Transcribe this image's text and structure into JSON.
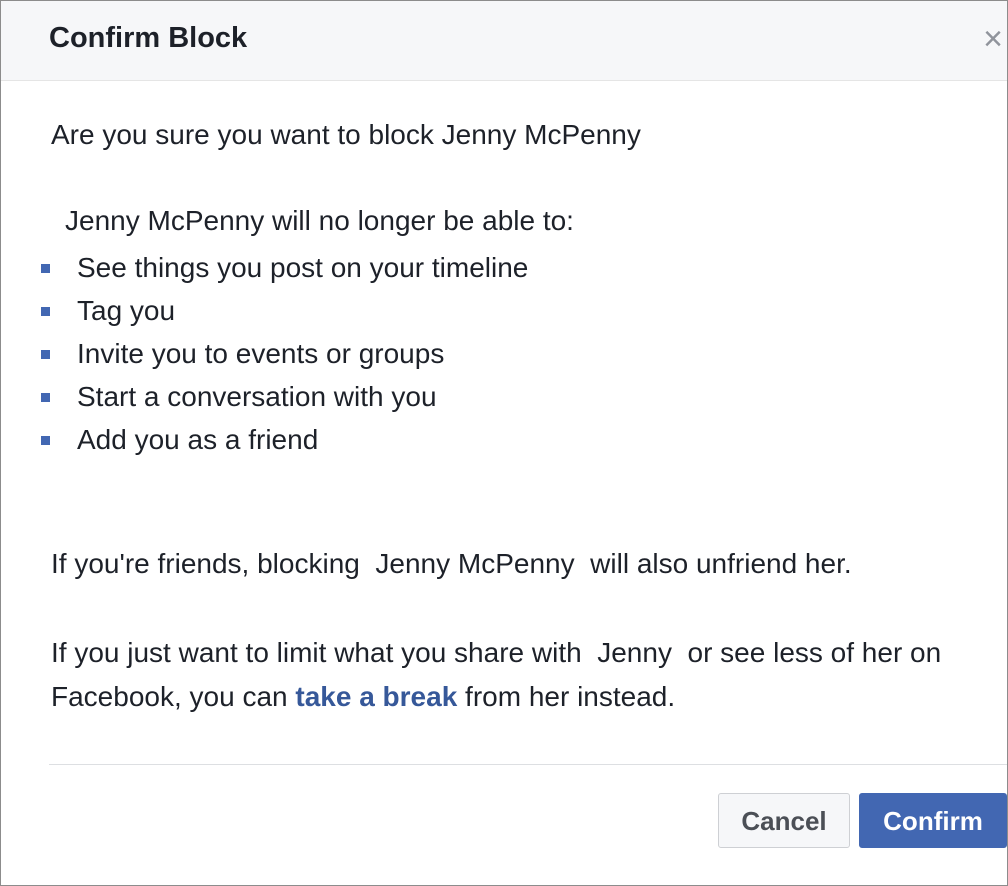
{
  "dialog": {
    "title": "Confirm Block",
    "close_glyph": "×"
  },
  "body": {
    "question": "Are you sure you want to block Jenny McPenny",
    "intro": "Jenny McPenny will no longer be able to:",
    "restrictions": [
      "See things you post on your timeline",
      "Tag you",
      "Invite you to events or groups",
      "Start a conversation with you",
      "Add you as a friend"
    ],
    "unfriend_note": "If you're friends, blocking  Jenny McPenny  will also unfriend her.",
    "limit_prefix": "If you just want to limit what you share with  Jenny  or see less of her on Facebook, you can ",
    "limit_link": "take a break",
    "limit_suffix": " from her instead."
  },
  "footer": {
    "cancel_label": "Cancel",
    "confirm_label": "Confirm"
  },
  "colors": {
    "accent": "#4267b2",
    "link": "#365899",
    "header_bg": "#f6f7f9",
    "text": "#1d2129"
  },
  "icons": {
    "close": "close-icon",
    "bullet": "square-bullet-icon"
  }
}
